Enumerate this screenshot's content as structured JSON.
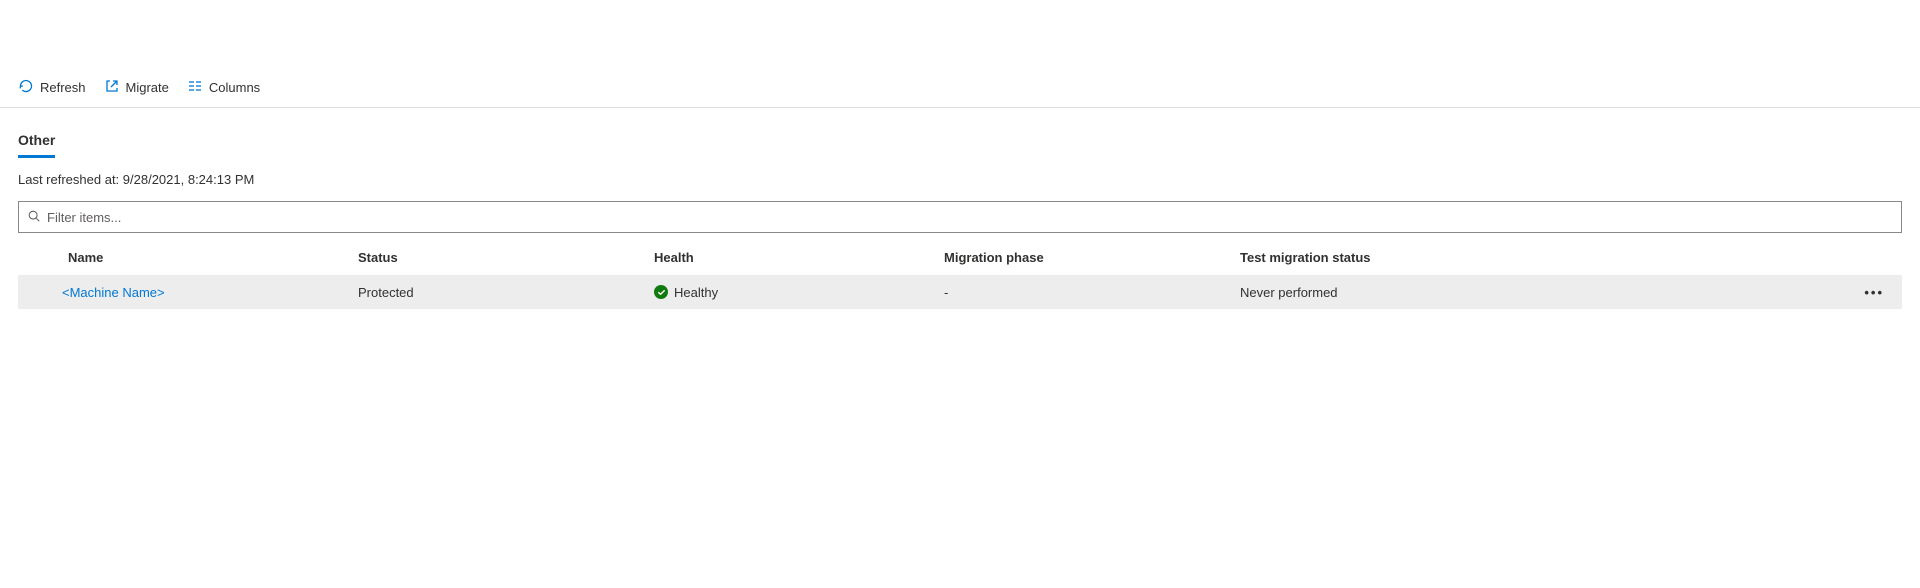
{
  "toolbar": {
    "refresh_label": "Refresh",
    "migrate_label": "Migrate",
    "columns_label": "Columns"
  },
  "tabs": {
    "other": "Other"
  },
  "refresh_line": {
    "prefix": "Last refreshed at: ",
    "timestamp": "9/28/2021, 8:24:13 PM"
  },
  "filter": {
    "placeholder": "Filter items..."
  },
  "columns": {
    "name": "Name",
    "status": "Status",
    "health": "Health",
    "migration_phase": "Migration phase",
    "test_migration_status": "Test migration status"
  },
  "rows": [
    {
      "name": "<Machine Name>",
      "status": "Protected",
      "health": "Healthy",
      "migration_phase": "-",
      "test_migration_status": "Never performed"
    }
  ]
}
